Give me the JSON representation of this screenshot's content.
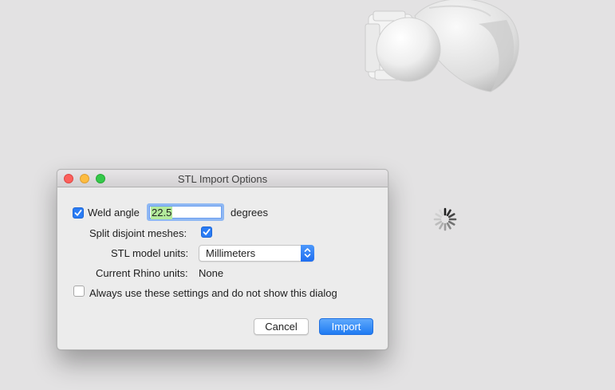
{
  "dialog": {
    "title": "STL Import Options",
    "weld_angle": {
      "label": "Weld angle",
      "checked": true,
      "value": "22.5",
      "unit": "degrees"
    },
    "split_disjoint": {
      "label": "Split disjoint meshes:",
      "checked": true
    },
    "model_units": {
      "label": "STL model units:",
      "selected": "Millimeters"
    },
    "rhino_units": {
      "label": "Current Rhino units:",
      "value": "None"
    },
    "always_use": {
      "label": "Always use these settings and do not show this dialog",
      "checked": false
    },
    "buttons": {
      "cancel": "Cancel",
      "import": "Import"
    }
  },
  "colors": {
    "accent": "#2a7cf4",
    "background": "#e3e2e3",
    "dialog": "#ececec",
    "close": "#fc605c",
    "minimize": "#fdbc40",
    "maximize": "#34c84a",
    "field_highlight": "#b3ea9c"
  },
  "icons": {
    "loading": "spinner-icon",
    "checkmark": "checkmark-icon",
    "popup": "chevron-updown-icon"
  }
}
